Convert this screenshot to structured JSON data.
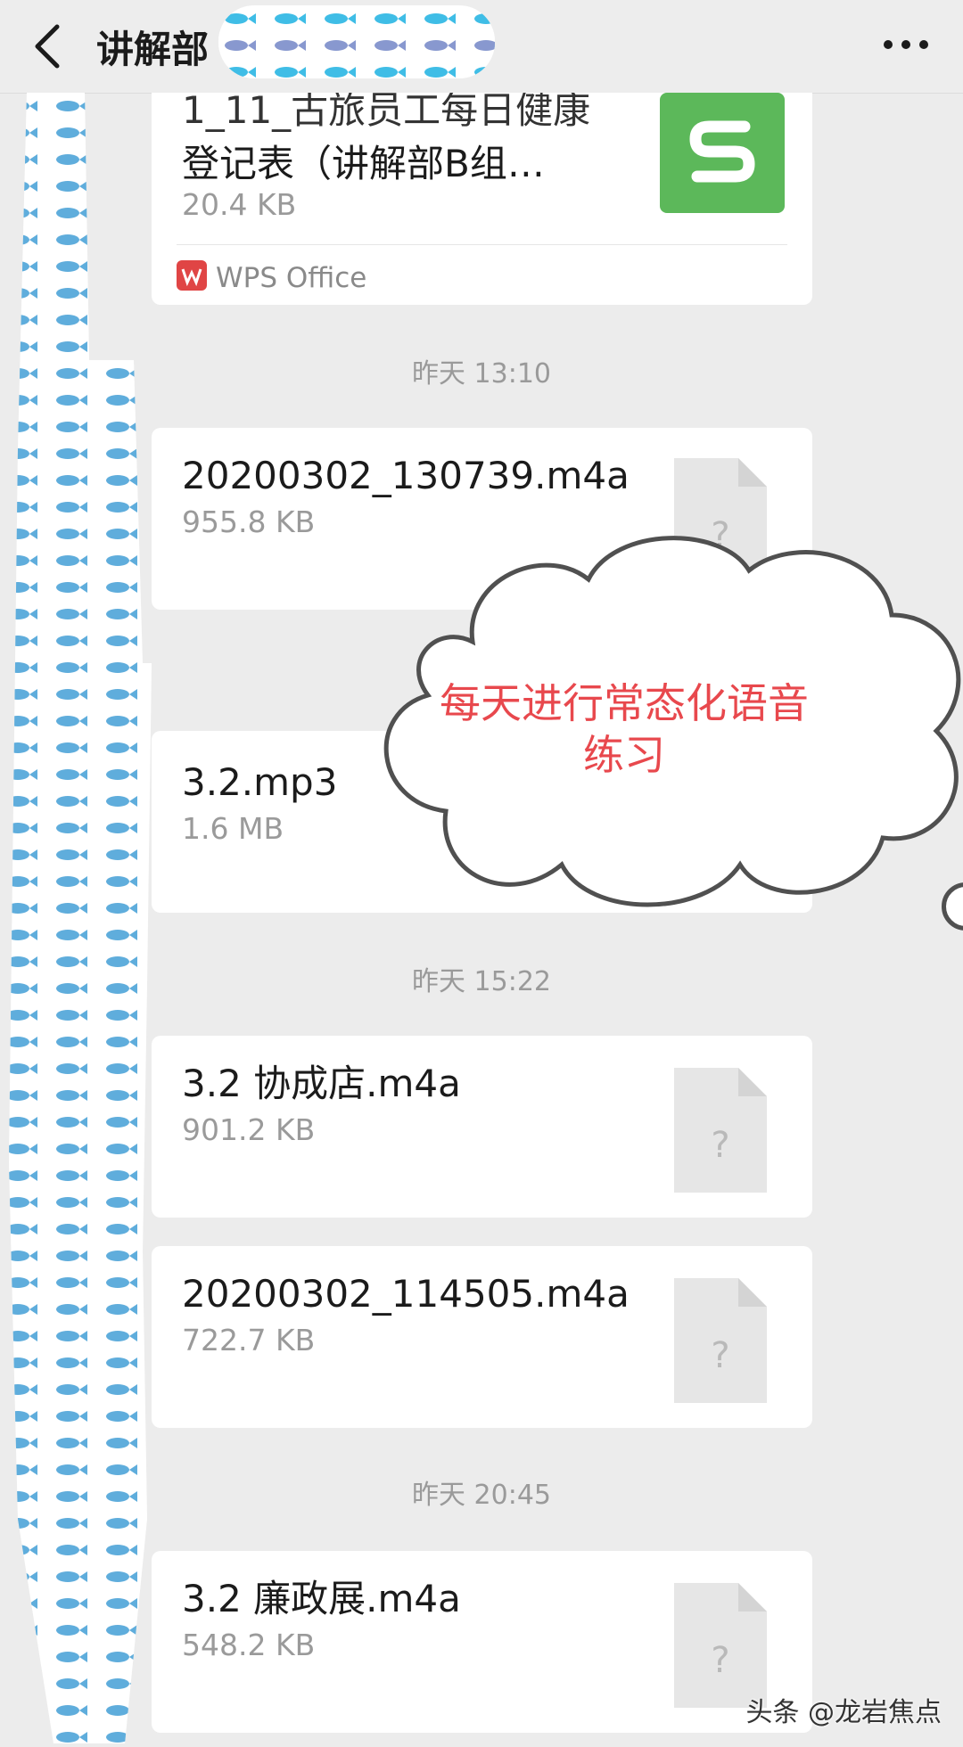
{
  "header": {
    "back_icon": "chevron-left-icon",
    "title": "讲解部",
    "more_icon": "more-dots-icon"
  },
  "messages": [
    {
      "name_line1": "1_11_古旅员工每日健康",
      "name_line2": "登记表（讲解部B组…",
      "size": "20.4 KB",
      "app": "WPS  Office",
      "icon": "wps-sheet-icon"
    },
    {
      "timestamp": "昨天 13:10"
    },
    {
      "name": "20200302_130739.m4a",
      "size": "955.8 KB",
      "icon": "unknown-file-icon"
    },
    {
      "name": "3.2.mp3",
      "size": "1.6 MB",
      "icon": "unknown-file-icon"
    },
    {
      "timestamp": "昨天 15:22"
    },
    {
      "name": "3.2 协成店.m4a",
      "size": "901.2 KB",
      "icon": "unknown-file-icon"
    },
    {
      "name": "20200302_114505.m4a",
      "size": "722.7 KB",
      "icon": "unknown-file-icon"
    },
    {
      "timestamp": "昨天 20:45"
    },
    {
      "name": "3.2 廉政展.m4a",
      "size": "548.2 KB",
      "icon": "unknown-file-icon"
    }
  ],
  "annotation": {
    "line1": "每天进行常态化语音",
    "line2": "练习",
    "color": "#e8484d"
  },
  "watermark": "头条 @龙岩焦点",
  "colors": {
    "wps_green": "#5cb85a",
    "mask_blue": "#3fbde6",
    "mask_purple": "#9a8fc9"
  }
}
